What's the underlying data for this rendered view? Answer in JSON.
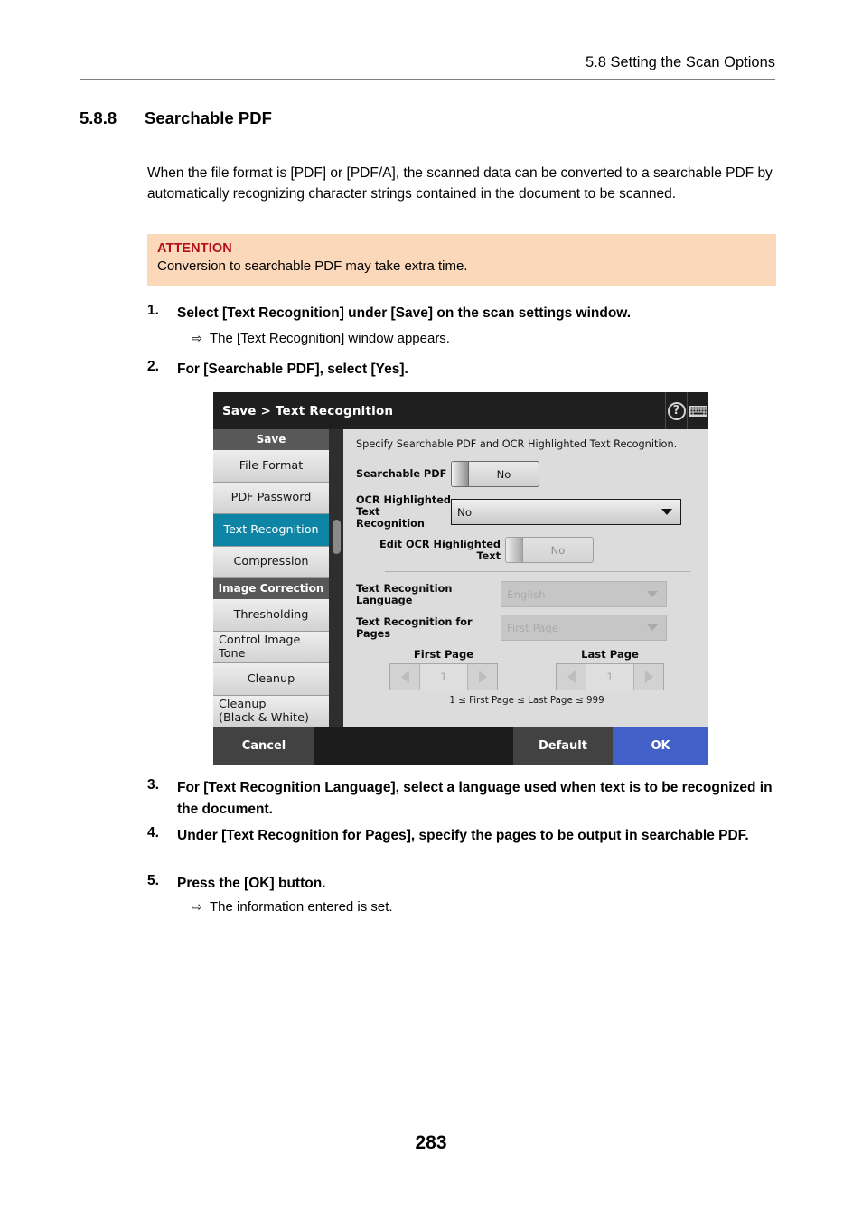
{
  "header": {
    "running_head": "5.8 Setting the Scan Options"
  },
  "section": {
    "number": "5.8.8",
    "title": "Searchable PDF"
  },
  "intro": "When the file format is [PDF] or [PDF/A], the scanned data can be converted to a searchable PDF by automatically recognizing character strings contained in the document to be scanned.",
  "attention": {
    "title": "ATTENTION",
    "body": "Conversion to searchable PDF may take extra time.",
    "bg_color": "#fbd8ba",
    "title_color": "#b11116"
  },
  "steps": [
    {
      "num": "1.",
      "text": "Select [Text Recognition] under [Save] on the scan settings window."
    },
    {
      "num": "2.",
      "text": "For [Searchable PDF], select [Yes]."
    },
    {
      "num": "3.",
      "text": "For [Text Recognition Language], select a language used when text is to be recognized in the document."
    },
    {
      "num": "4.",
      "text": "Under [Text Recognition for Pages], specify the pages to be output in searchable PDF."
    },
    {
      "num": "5.",
      "text": "Press the [OK] button."
    }
  ],
  "results": [
    {
      "arrow": "⇨",
      "text": "The [Text Recognition] window appears."
    },
    {
      "arrow": "⇨",
      "text": "The information entered is set."
    }
  ],
  "device": {
    "titlebar": {
      "title": "Save > Text Recognition",
      "help_icon": "help-circle-icon",
      "keyboard_icon": "keyboard-icon"
    },
    "sidebar": {
      "items": [
        {
          "label": "Save",
          "type": "group"
        },
        {
          "label": "File Format",
          "type": "item"
        },
        {
          "label": "PDF Password",
          "type": "item"
        },
        {
          "label": "Text Recognition",
          "type": "item",
          "selected": true
        },
        {
          "label": "Compression",
          "type": "item"
        },
        {
          "label": "Image Correction",
          "type": "group"
        },
        {
          "label": "Thresholding",
          "type": "item"
        },
        {
          "label": "Control Image",
          "label2": "Tone",
          "type": "item"
        },
        {
          "label": "Cleanup",
          "type": "item"
        },
        {
          "label": "Cleanup",
          "label2": "(Black & White)",
          "type": "item"
        }
      ],
      "selected_color": "#0f85a6"
    },
    "panel": {
      "description": "Specify Searchable PDF and OCR Highlighted Text Recognition.",
      "fields": {
        "searchable_pdf": {
          "label": "Searchable PDF",
          "value": "No",
          "control": "toggle",
          "enabled": true
        },
        "ocr_highlighted": {
          "label_line1": "OCR Highlighted",
          "label_line2": "Text Recognition",
          "value": "No",
          "control": "dropdown",
          "enabled": true
        },
        "edit_ocr": {
          "label": "Edit OCR Highlighted Text",
          "value": "No",
          "control": "toggle",
          "enabled": false
        },
        "language": {
          "label": "Text Recognition Language",
          "value": "English",
          "control": "dropdown",
          "enabled": false
        },
        "for_pages": {
          "label": "Text Recognition for Pages",
          "value": "First Page",
          "control": "dropdown",
          "enabled": false
        }
      },
      "steppers": {
        "first_page": {
          "title": "First Page",
          "value": "1"
        },
        "last_page": {
          "title": "Last Page",
          "value": "1"
        }
      },
      "range_note": "1 ≤ First Page ≤ Last Page ≤ 999"
    },
    "footer": {
      "cancel": "Cancel",
      "default": "Default",
      "ok": "OK",
      "ok_color": "#4260c8"
    }
  },
  "page_number": "283"
}
